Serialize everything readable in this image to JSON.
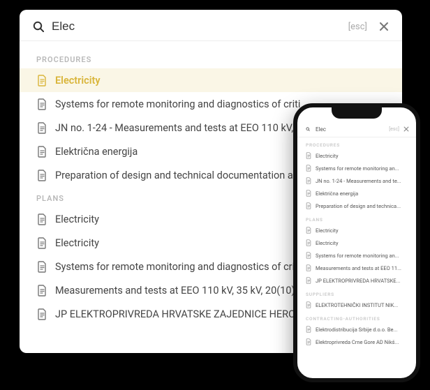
{
  "desktop": {
    "search": {
      "value": "Elec",
      "placeholder": ""
    },
    "esc_label": "[esc]",
    "sections": {
      "procedures": {
        "label": "PROCEDURES",
        "items": [
          {
            "label": "Electricity",
            "active": true
          },
          {
            "label": "Systems for remote monitoring and diagnostics of criti"
          },
          {
            "label": "JN no. 1-24 - Measurements and tests at EEO 110 kV, 3"
          },
          {
            "label": "Električna energija"
          },
          {
            "label": "Preparation of design and technical documentation an"
          }
        ]
      },
      "plans": {
        "label": "PLANS",
        "items": [
          {
            "label": "Electricity"
          },
          {
            "label": "Electricity"
          },
          {
            "label": "Systems for remote monitoring and diagnostics of cri"
          },
          {
            "label": "Measurements and tests at EEO 110 kV, 35 kV, 20(10)"
          },
          {
            "label": "JP ELEKTROPRIVREDA HRVATSKE ZAJEDNICE HERC"
          }
        ]
      }
    }
  },
  "mobile": {
    "search": {
      "value": "Elec"
    },
    "esc_label": "[esc]",
    "sections": {
      "procedures": {
        "label": "PROCEDURES",
        "items": [
          {
            "label": "Electricity"
          },
          {
            "label": "Systems for remote monitoring an..."
          },
          {
            "label": "JN no. 1-24 - Measurements and te..."
          },
          {
            "label": "Električna energija"
          },
          {
            "label": "Preparation of design and technica..."
          }
        ]
      },
      "plans": {
        "label": "PLANS",
        "items": [
          {
            "label": "Electricity"
          },
          {
            "label": "Electricity"
          },
          {
            "label": "Systems for remote monitoring an..."
          },
          {
            "label": "Measurements and tests at EEO 11..."
          },
          {
            "label": "JP ELEKTROPRIVREDA HRVATSKE..."
          }
        ]
      },
      "suppliers": {
        "label": "SUPPLIERS",
        "items": [
          {
            "label": "ELEKTROTEHNIČKI INSTITUT NIK..."
          }
        ]
      },
      "contracting": {
        "label": "CONTRACTING-AUTHORITIES",
        "items": [
          {
            "label": "Elektrodistribucija Srbije d.o.o. Be..."
          },
          {
            "label": "Elektroprivreda Crne Gore AD Nikš..."
          }
        ]
      }
    }
  }
}
